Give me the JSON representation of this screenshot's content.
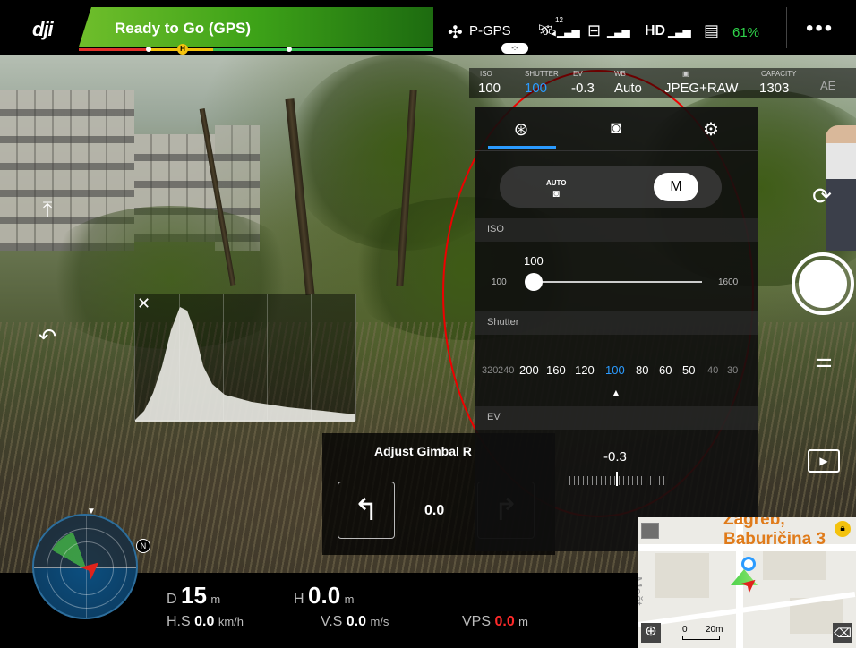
{
  "topbar": {
    "logo": "dji",
    "status": "Ready to Go (GPS)",
    "flight_mode": "P-GPS",
    "satellite_count": "12",
    "hd_label": "HD",
    "battery_percent": "61%",
    "menu_icon": "more-dots-icon"
  },
  "camera_params": {
    "iso_label": "ISO",
    "iso_value": "100",
    "shutter_label": "SHUTTER",
    "shutter_value": "100",
    "ev_label": "EV",
    "ev_value": "-0.3",
    "wb_label": "WB",
    "wb_value": "Auto",
    "format_value": "JPEG+RAW",
    "capacity_label": "CAPACITY",
    "capacity_value": "1303",
    "ae_label": "AE"
  },
  "settings_panel": {
    "tabs": [
      "aperture-icon",
      "camera-icon",
      "gear-icon"
    ],
    "mode_auto": "AUTO",
    "mode_manual": "M",
    "iso_section": "ISO",
    "iso_current": "100",
    "iso_min": "100",
    "iso_max": "1600",
    "iso_level": 0.0,
    "shutter_section": "Shutter",
    "shutter_values": [
      "320",
      "240",
      "200",
      "160",
      "120",
      "100",
      "80",
      "60",
      "50",
      "40",
      "30"
    ],
    "shutter_selected": "100",
    "ev_section": "EV",
    "ev_current": "-0.3"
  },
  "gimbal": {
    "title": "Adjust Gimbal R",
    "value": "0.0"
  },
  "telemetry": {
    "d_label": "D",
    "d_value": "15",
    "d_unit": "m",
    "h_label": "H",
    "h_value": "0.0",
    "h_unit": "m",
    "hs_label": "H.S",
    "hs_value": "0.0",
    "hs_unit": "km/h",
    "vs_label": "V.S",
    "vs_value": "0.0",
    "vs_unit": "m/s",
    "vps_label": "VPS",
    "vps_value": "0.0",
    "vps_unit": "m"
  },
  "radar": {
    "north_label": "N"
  },
  "map": {
    "city": "Zagreb,",
    "street": "Baburičina 3",
    "district": "Mešt",
    "scale_zero": "0",
    "scale_value": "20m"
  },
  "colors": {
    "accent_blue": "#2b9bff",
    "status_green": "#3da218",
    "battery_green": "#2fd24a",
    "annotation_red": "#e00000",
    "vps_red": "#ff2a2a"
  }
}
